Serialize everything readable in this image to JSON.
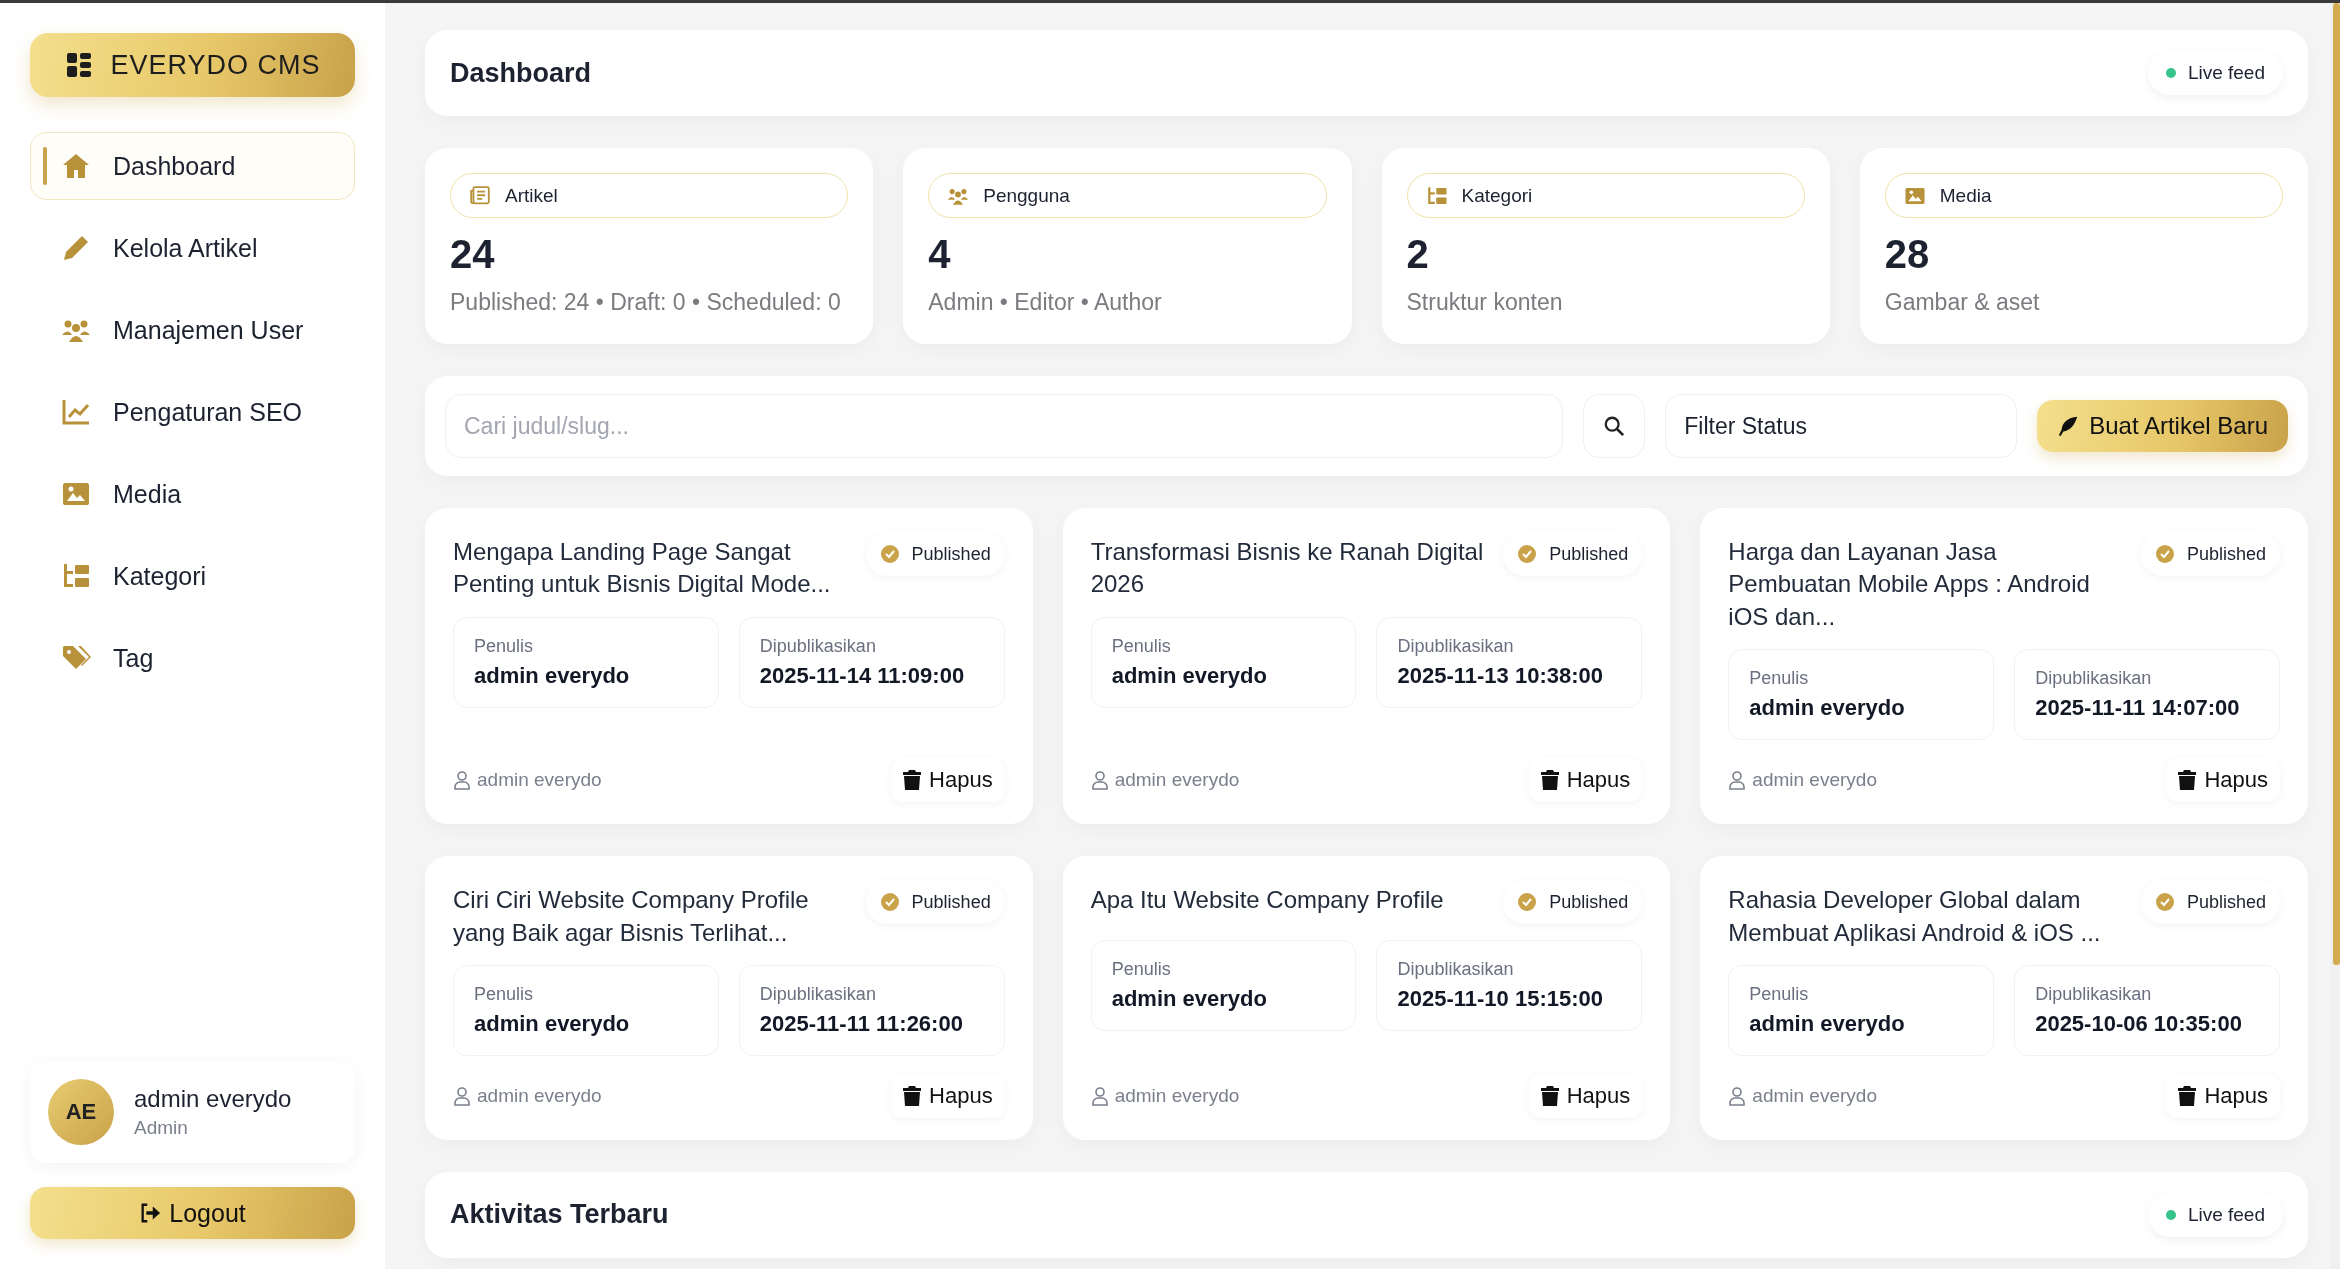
{
  "brand": {
    "title": "EVERYDO CMS"
  },
  "nav": [
    {
      "label": "Dashboard",
      "selected": true
    },
    {
      "label": "Kelola Artikel",
      "selected": false
    },
    {
      "label": "Manajemen User",
      "selected": false
    },
    {
      "label": "Pengaturan SEO",
      "selected": false
    },
    {
      "label": "Media",
      "selected": false
    },
    {
      "label": "Kategori",
      "selected": false
    },
    {
      "label": "Tag",
      "selected": false
    }
  ],
  "user": {
    "initials": "AE",
    "name": "admin everydo",
    "role": "Admin"
  },
  "logout": "Logout",
  "header": {
    "title": "Dashboard",
    "live": "Live feed"
  },
  "stats": [
    {
      "label": "Artikel",
      "value": "24",
      "detail": "Published: 24 • Draft: 0 • Scheduled: 0"
    },
    {
      "label": "Pengguna",
      "value": "4",
      "detail": "Admin • Editor • Author"
    },
    {
      "label": "Kategori",
      "value": "2",
      "detail": "Struktur konten"
    },
    {
      "label": "Media",
      "value": "28",
      "detail": "Gambar & aset"
    }
  ],
  "toolbar": {
    "search": {
      "placeholder": "Cari judul/slug..."
    },
    "filter": "Filter Status",
    "new_button": "Buat Artikel Baru"
  },
  "articles": [
    {
      "title": "Mengapa Landing Page Sangat Penting untuk Bisnis Digital Mode...",
      "status": "Published",
      "author_label": "Penulis",
      "author": "admin everydo",
      "date_label": "Dipublikasikan",
      "date": "2025-11-14 11:09:00",
      "byline": "admin everydo",
      "delete": "Hapus"
    },
    {
      "title": "Transformasi Bisnis ke Ranah Digital 2026",
      "status": "Published",
      "author_label": "Penulis",
      "author": "admin everydo",
      "date_label": "Dipublikasikan",
      "date": "2025-11-13 10:38:00",
      "byline": "admin everydo",
      "delete": "Hapus"
    },
    {
      "title": "Harga dan Layanan Jasa Pembuatan Mobile Apps : Android iOS dan...",
      "status": "Published",
      "author_label": "Penulis",
      "author": "admin everydo",
      "date_label": "Dipublikasikan",
      "date": "2025-11-11 14:07:00",
      "byline": "admin everydo",
      "delete": "Hapus"
    },
    {
      "title": "Ciri Ciri Website Company Profile yang Baik agar Bisnis Terlihat...",
      "status": "Published",
      "author_label": "Penulis",
      "author": "admin everydo",
      "date_label": "Dipublikasikan",
      "date": "2025-11-11 11:26:00",
      "byline": "admin everydo",
      "delete": "Hapus"
    },
    {
      "title": "Apa Itu Website Company Profile",
      "status": "Published",
      "author_label": "Penulis",
      "author": "admin everydo",
      "date_label": "Dipublikasikan",
      "date": "2025-11-10 15:15:00",
      "byline": "admin everydo",
      "delete": "Hapus"
    },
    {
      "title": "Rahasia Developer Global dalam Membuat Aplikasi Android & iOS ...",
      "status": "Published",
      "author_label": "Penulis",
      "author": "admin everydo",
      "date_label": "Dipublikasikan",
      "date": "2025-10-06 10:35:00",
      "byline": "admin everydo",
      "delete": "Hapus"
    }
  ],
  "activity": {
    "title": "Aktivitas Terbaru",
    "live": "Live feed"
  }
}
